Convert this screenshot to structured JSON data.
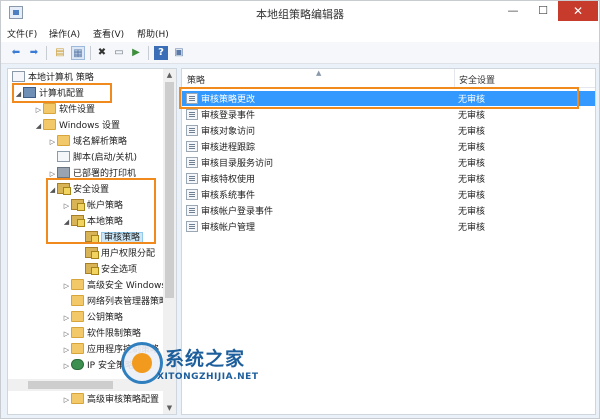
{
  "window": {
    "title": "本地组策略编辑器",
    "min_glyph": "—",
    "max_glyph": "☐",
    "close_glyph": "✕"
  },
  "menu": [
    "文件(F)",
    "操作(A)",
    "查看(V)",
    "帮助(H)"
  ],
  "toolbar": {
    "buttons": [
      {
        "icon": "back-arrow-icon",
        "glyph": "⬅"
      },
      {
        "icon": "forward-arrow-icon",
        "glyph": "➡"
      },
      {
        "icon": "up-folder-icon",
        "glyph": "▤"
      },
      {
        "icon": "show-tree-icon",
        "glyph": "▦"
      },
      {
        "icon": "delete-icon",
        "glyph": "✖"
      },
      {
        "icon": "properties-icon",
        "glyph": "▭"
      },
      {
        "icon": "export-list-icon",
        "glyph": "▶"
      },
      {
        "icon": "help-icon",
        "glyph": "?"
      },
      {
        "icon": "view-icon",
        "glyph": "▣"
      }
    ]
  },
  "tree": {
    "root": "本地计算机 策略",
    "computer_config": "计算机配置",
    "software_settings": "软件设置",
    "windows_settings": "Windows 设置",
    "dns_policy": "域名解析策略",
    "scripts": "脚本(启动/关机)",
    "deployed_printers": "已部署的打印机",
    "security_settings": "安全设置",
    "account_policies": "帐户策略",
    "local_policies": "本地策略",
    "audit_policy": "审核策略",
    "user_rights": "用户权限分配",
    "security_options": "安全选项",
    "advanced_firewall": "高级安全 Windows",
    "network_list": "网络列表管理器策略",
    "public_key": "公钥策略",
    "software_restriction": "软件限制策略",
    "app_control": "应用程序控制策略",
    "ip_security": "IP 安全策略，在",
    "advanced_audit": "高级审核策略配置"
  },
  "list": {
    "columns": [
      "策略",
      "安全设置"
    ],
    "rows": [
      {
        "name": "审核策略更改",
        "setting": "无审核"
      },
      {
        "name": "审核登录事件",
        "setting": "无审核"
      },
      {
        "name": "审核对象访问",
        "setting": "无审核"
      },
      {
        "name": "审核进程跟踪",
        "setting": "无审核"
      },
      {
        "name": "审核目录服务访问",
        "setting": "无审核"
      },
      {
        "name": "审核特权使用",
        "setting": "无审核"
      },
      {
        "name": "审核系统事件",
        "setting": "无审核"
      },
      {
        "name": "审核帐户登录事件",
        "setting": "无审核"
      },
      {
        "name": "审核帐户管理",
        "setting": "无审核"
      }
    ]
  },
  "watermark": {
    "title": "系统之家",
    "url": "XITONGZHIJIA.NET"
  },
  "colors": {
    "highlight_box": "#f08a1c",
    "selection": "#3399ff",
    "close_button": "#c73b2c"
  }
}
